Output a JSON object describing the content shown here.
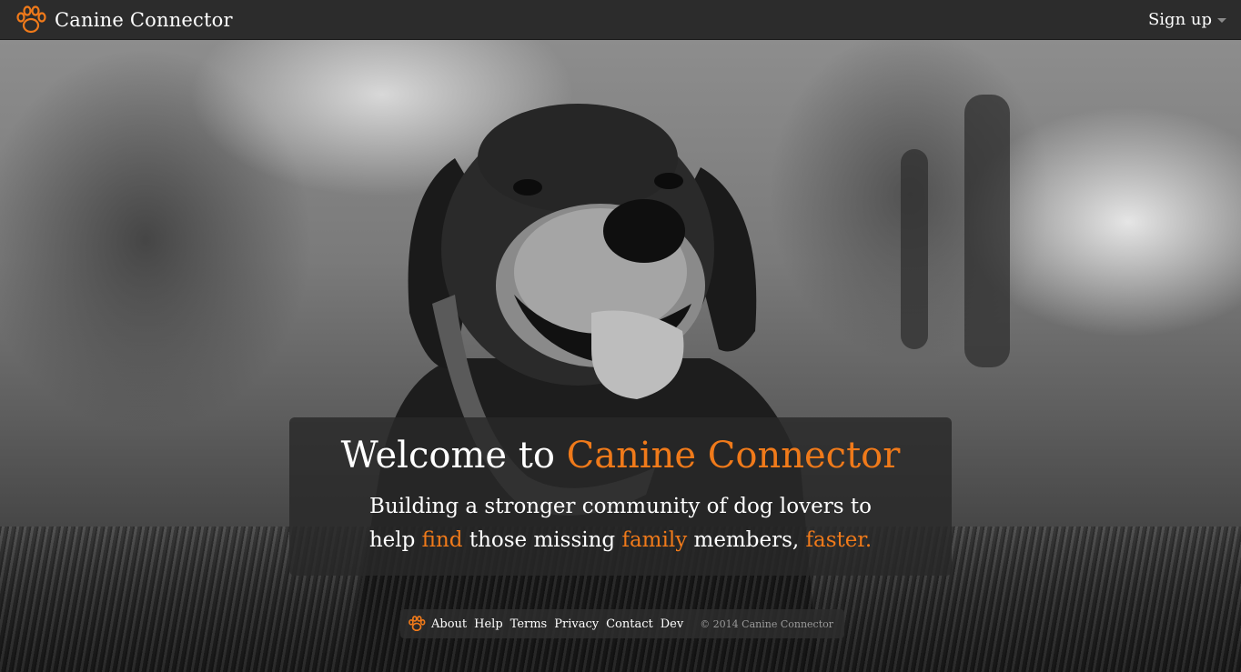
{
  "nav": {
    "brand_name": "Canine Connector",
    "brand_icon": "paw-icon",
    "signup_label": "Sign up",
    "signup_icon": "caret-down-icon"
  },
  "welcome": {
    "title_prefix": "Welcome to ",
    "title_accent": "Canine Connector",
    "line1": "Building a stronger community of dog lovers to",
    "line2_part1": "help ",
    "line2_find": "find",
    "line2_part2": " those missing ",
    "line2_family": "family",
    "line2_part3": " members, ",
    "line2_faster": "faster."
  },
  "footer": {
    "icon": "paw-icon",
    "links": [
      "About",
      "Help",
      "Terms",
      "Privacy",
      "Contact",
      "Dev"
    ],
    "copyright": "© 2014 Canine Connector"
  },
  "colors": {
    "accent": "#f07a1a",
    "navbar": "#2c2c2c",
    "panel": "#282828"
  }
}
